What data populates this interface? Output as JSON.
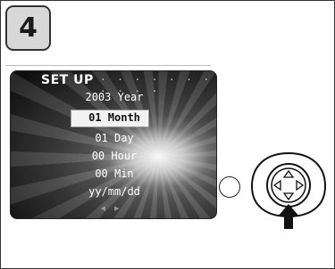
{
  "step": {
    "number": "4"
  },
  "menu": {
    "title": "SET UP",
    "dots": "· · · · · · · · · · ·",
    "rows": {
      "year": "2003 Year",
      "month": "01 Month",
      "day": "01 Day",
      "hour": "00 Hour",
      "min": "00 Min",
      "format": "yy/mm/dd"
    },
    "selected_row": "month"
  },
  "controls": {
    "pad_icon": "four-way-controller-icon",
    "press_icon": "arrow-up-icon",
    "indicator_icon": "circle-icon"
  }
}
